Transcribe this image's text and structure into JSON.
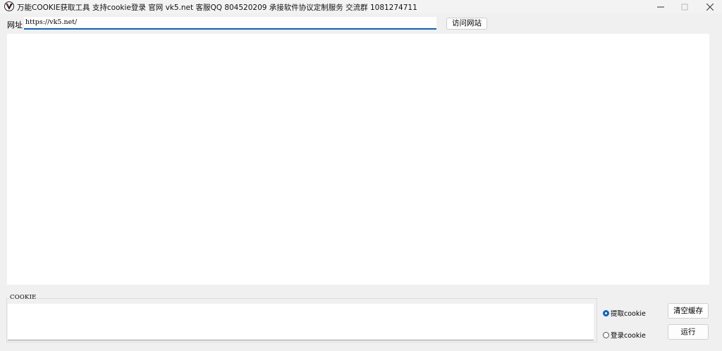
{
  "window": {
    "title": "万能COOKIE获取工具 支持cookie登录 官网 vk5.net 客服QQ 804520209 承接软件协议定制服务 交流群 1081274711"
  },
  "address_bar": {
    "label": "网址",
    "value": "https://vk5.net/"
  },
  "visit_button": {
    "label": "访问网站"
  },
  "cookie_panel": {
    "legend": "COOKIE",
    "value": ""
  },
  "options": {
    "extract_cookie": {
      "label": "提取cookie",
      "checked": true
    },
    "login_cookie": {
      "label": "登录cookie",
      "checked": false
    }
  },
  "buttons": {
    "clear_cache": "清空缓存",
    "run": "运行"
  },
  "colors": {
    "accent": "#0a64c8",
    "window_bg": "#f0f0f0"
  }
}
